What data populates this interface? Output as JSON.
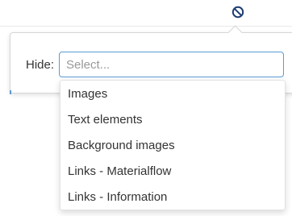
{
  "toolbar": {
    "hide_icon": "forbidden-circle-icon",
    "accent_color": "#1f3f73"
  },
  "hide_filter": {
    "label": "Hide:",
    "placeholder": "Select...",
    "options": [
      "Images",
      "Text elements",
      "Background images",
      "Links - Materialflow",
      "Links - Information"
    ]
  }
}
